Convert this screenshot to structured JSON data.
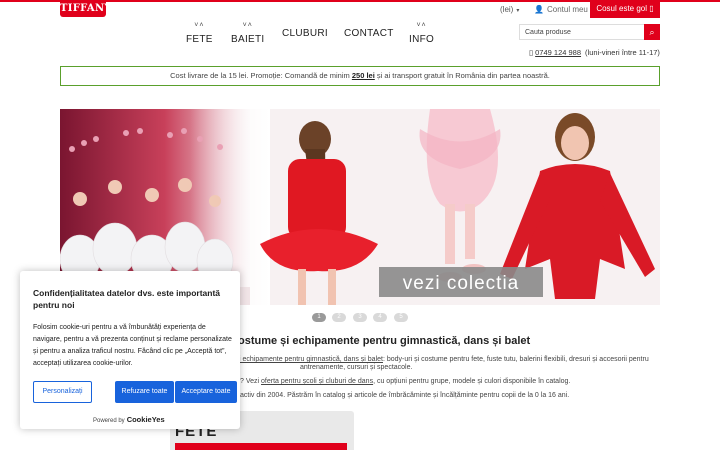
{
  "header": {
    "logo_text": "TIFFANY",
    "currency_label": "(lei)",
    "currency_caret": "▾",
    "account_icon": "👤",
    "account_label": "Contul meu",
    "account_caret": "▾",
    "cart_label": "Cosul este gol",
    "cart_icon": "▯",
    "search_placeholder": "Cauta produse",
    "search_icon": "⌕",
    "phone_icon": "▯",
    "phone_number": "0749 124 988",
    "phone_hours": "(luni-vineri între 11-17)",
    "brand_color": "#e0001b"
  },
  "nav": {
    "chevron": "˅˄",
    "items": [
      {
        "label": "FETE"
      },
      {
        "label": "BAIETI"
      },
      {
        "label": "CLUBURI"
      },
      {
        "label": "CONTACT"
      },
      {
        "label": "INFO"
      }
    ]
  },
  "promo": {
    "part1": "Cost livrare de la 15 lei. Promoție: Comandă de minim ",
    "amount": "250 lei",
    "part2": " și ai transport gratuit în România din partea noastră."
  },
  "slider": {
    "banner_text": "vezi  colectia",
    "dots": [
      "1",
      "2",
      "3",
      "4",
      "5"
    ],
    "active_dot": 1
  },
  "main": {
    "heading": "ostume și echipamente pentru gimnastică, dans și balet",
    "p1_link": "i echipamente pentru gimnastică, dans și balet",
    "p1_rest": ": body-uri și costume pentru fete, fuste tutu, balerini flexibili, dresuri și accesorii pentru",
    "p1_line2": "antrenamente, cursuri și spectacole.",
    "p2_pre": "? Vezi ",
    "p2_link": "oferta pentru școli și cluburi de dans",
    "p2_rest": ", cu opțiuni pentru grupe, modele și culori disponibile în catalog.",
    "p3": "activ din 2004. Păstrăm în catalog și articole de îmbrăcăminte și încălțăminte pentru copii de la 0 la 16 ani.",
    "category_title": "FETE"
  },
  "cookie": {
    "title": "Confidențialitatea datelor dvs. este importantă pentru noi",
    "body": "Folosim cookie-uri pentru a vă îmbunătăți experiența de navigare, pentru a vă prezenta conținut și reclame personalizate și pentru a analiza traficul nostru. Făcând clic pe „Acceptă tot”, acceptați utilizarea cookie-urilor.",
    "btn_customize": "Personalizați",
    "btn_reject": "Refuzare toate",
    "btn_accept": "Acceptare toate",
    "powered_by": "Powered by",
    "powered_brand": "CookieYes",
    "accent_color": "#1863dc"
  }
}
